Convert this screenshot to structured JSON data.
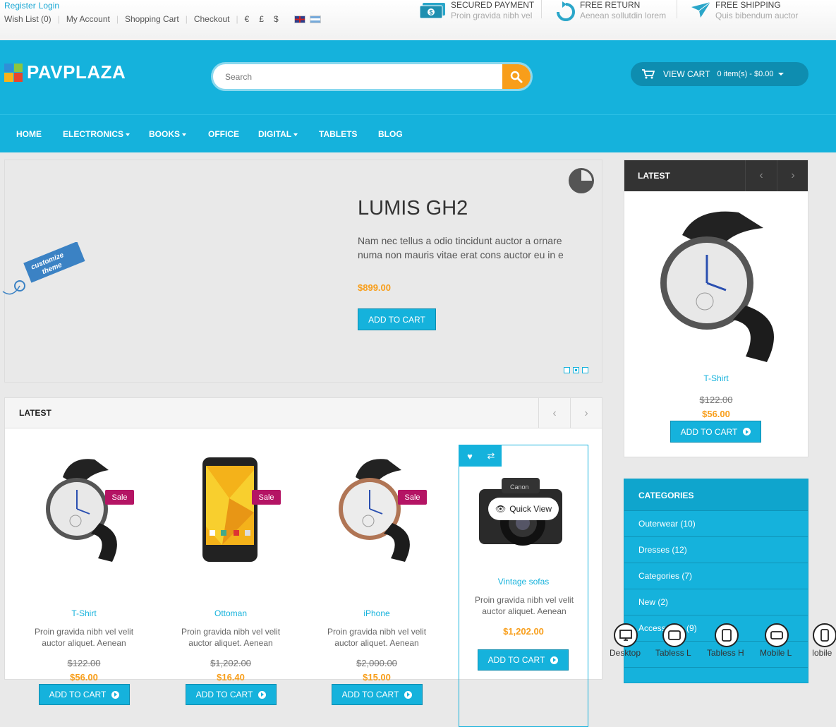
{
  "topbar": {
    "register": "Register",
    "login": "Login",
    "links": [
      "Wish List (0)",
      "My Account",
      "Shopping Cart",
      "Checkout"
    ],
    "currencies": [
      "€",
      "£",
      "$"
    ],
    "features": [
      {
        "title": "SECURED PAYMENT",
        "sub": "Proin gravida nibh vel",
        "icon": "money-icon"
      },
      {
        "title": "FREE RETURN",
        "sub": "Aenean sollutdin lorem",
        "icon": "refresh-icon"
      },
      {
        "title": "FREE SHIPPING",
        "sub": "Quis bibendum auctor",
        "icon": "paper-plane-icon"
      }
    ]
  },
  "header": {
    "logo": "PAVPLAZA",
    "search_placeholder": "Search",
    "cart_label": "VIEW CART",
    "cart_items": "0 item(s) - $0.00"
  },
  "nav": {
    "items": [
      "HOME",
      "ELECTRONICS",
      "BOOKS",
      "OFFICE",
      "DIGITAL",
      "TABLETS",
      "BLOG"
    ]
  },
  "slider": {
    "title": "LUMIS GH2",
    "desc": "Nam nec tellus a odio tincidunt auctor a ornare numa non mauris vitae erat cons auctor eu in e",
    "price": "$899.00",
    "button": "ADD TO CART",
    "customize": [
      "customize",
      "theme"
    ]
  },
  "latest": {
    "title": "LATEST",
    "products": [
      {
        "name": "T-Shirt",
        "desc": "Proin gravida nibh vel velit auctor aliquet. Aenean",
        "old": "$122.00",
        "price": "$56.00",
        "sale": "Sale",
        "button": "ADD TO CART"
      },
      {
        "name": "Ottoman",
        "desc": "Proin gravida nibh vel velit auctor aliquet. Aenean",
        "old": "$1,202.00",
        "price": "$16.40",
        "sale": "Sale",
        "button": "ADD TO CART"
      },
      {
        "name": "iPhone",
        "desc": "Proin gravida nibh vel velit auctor aliquet. Aenean",
        "old": "$2,000.00",
        "price": "$15.00",
        "sale": "Sale",
        "button": "ADD TO CART"
      },
      {
        "name": "Vintage sofas",
        "desc": "Proin gravida nibh vel velit auctor aliquet. Aenean",
        "price": "$1,202.00",
        "button": "ADD TO CART",
        "quick_view": "Quick View"
      }
    ]
  },
  "side_latest": {
    "title": "LATEST",
    "product": {
      "name": "T-Shirt",
      "old": "$122.00",
      "price": "$56.00",
      "button": "ADD TO CART"
    }
  },
  "categories": {
    "title": "CATEGORIES",
    "items": [
      "Outerwear (10)",
      "Dresses (12)",
      "Categories (7)",
      "New (2)",
      "Accessories (9)"
    ]
  },
  "devices": [
    "Desktop",
    "Tabless L",
    "Tabless H",
    "Mobile L",
    "Mobile"
  ],
  "colors": {
    "accent": "#15b2dc",
    "orange": "#f89e1a",
    "sale": "#b41464",
    "dark": "#333333"
  }
}
